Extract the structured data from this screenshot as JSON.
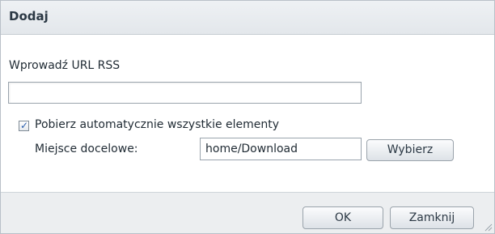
{
  "dialog": {
    "title": "Dodaj"
  },
  "form": {
    "url_label": "Wprowadź URL RSS",
    "url_value": "",
    "url_placeholder": "",
    "auto_download_label": "Pobierz automatycznie wszystkie elementy",
    "auto_download_checked": true,
    "destination_label": "Miejsce docelowe:",
    "destination_value": "home/Download",
    "browse_label": "Wybierz"
  },
  "footer": {
    "ok_label": "OK",
    "close_label": "Zamknij"
  },
  "icons": {
    "checkbox": "checkmark-icon",
    "grip": "resize-grip-icon"
  },
  "colors": {
    "title_bar": "#e8ebee",
    "footer": "#eceef0",
    "check": "#2a5fae",
    "text": "#1f2a33"
  }
}
